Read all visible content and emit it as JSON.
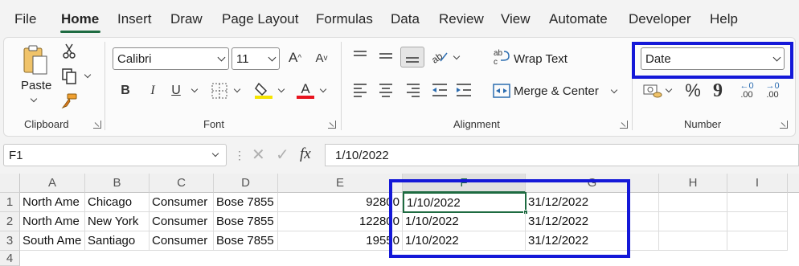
{
  "menu": {
    "items": [
      "File",
      "Home",
      "Insert",
      "Draw",
      "Page Layout",
      "Formulas",
      "Data",
      "Review",
      "View",
      "Automate",
      "Developer",
      "Help"
    ],
    "active": "Home"
  },
  "ribbon": {
    "clipboard": {
      "paste_label": "Paste",
      "group_label": "Clipboard"
    },
    "font": {
      "font_name": "Calibri",
      "font_size": "11",
      "bold": "B",
      "italic": "I",
      "underline": "U",
      "grow": "A",
      "shrink": "A",
      "font_color": "A",
      "group_label": "Font"
    },
    "alignment": {
      "wrap_text": "Wrap Text",
      "merge_center": "Merge & Center",
      "group_label": "Alignment"
    },
    "number": {
      "format": "Date",
      "percent": "%",
      "comma": "9",
      "inc_decimal": ".00",
      "dec_decimal": ".00",
      "inc_decimal_top": "←0",
      "dec_decimal_top": "→0",
      "group_label": "Number"
    }
  },
  "formula_bar": {
    "name_box": "F1",
    "fx": "fx",
    "formula": "1/10/2022"
  },
  "sheet": {
    "columns": [
      "A",
      "B",
      "C",
      "D",
      "E",
      "F",
      "G",
      "H",
      "I"
    ],
    "selected_column": "F",
    "rows": [
      {
        "num": "1",
        "cells": [
          "North Ame",
          "Chicago",
          "Consumer",
          "Bose 7855",
          "92800",
          "1/10/2022",
          "31/12/2022"
        ]
      },
      {
        "num": "2",
        "cells": [
          "North Ame",
          "New York",
          "Consumer",
          "Bose 7855",
          "122800",
          "1/10/2022",
          "31/12/2022"
        ]
      },
      {
        "num": "3",
        "cells": [
          "South Ame",
          "Santiago",
          "Consumer",
          "Bose 7855",
          "19550",
          "1/10/2022",
          "31/12/2022"
        ]
      }
    ],
    "empty_row_num": "4"
  },
  "colors": {
    "accent": "#1e6b41",
    "highlight": "#1418d8"
  }
}
